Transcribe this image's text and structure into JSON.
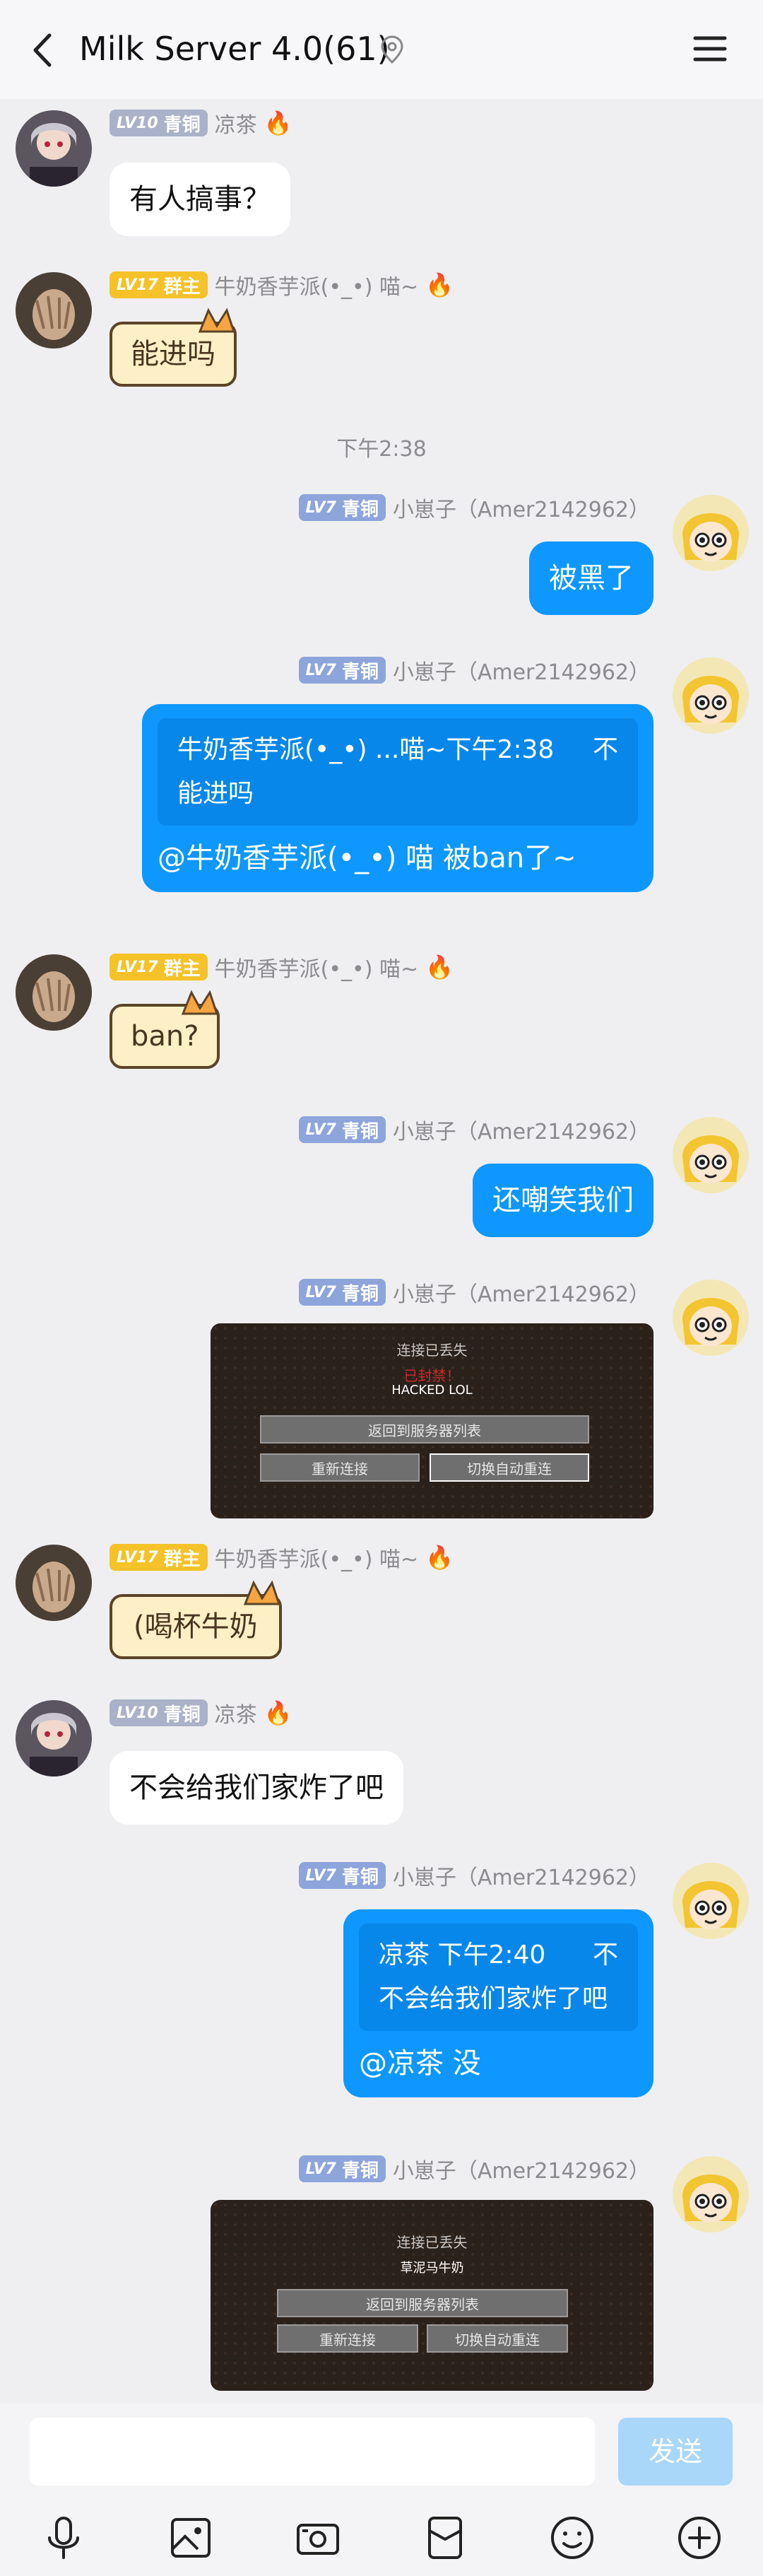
{
  "header": {
    "title": "Milk Server 4.0(61)"
  },
  "time_divider": "下午2:38",
  "users": {
    "liangcha": {
      "level": "LV10",
      "rank": "青铜",
      "name": "凉茶"
    },
    "niunai": {
      "level": "LV17",
      "rank": "群主",
      "name": "牛奶香芋派(•_•) 喵~"
    },
    "xiaozaizi": {
      "level": "LV7",
      "rank": "青铜",
      "name": "小崽子（Amer2142962）"
    }
  },
  "messages": {
    "m1": "有人搞事？",
    "m2": "能进吗",
    "m3": "被黑了",
    "m4_quote_line1": "牛奶香芋派(•_•) ...喵~下午2:38",
    "m4_quote_right": "不",
    "m4_quote_line2": "能进吗",
    "m4_text": "@牛奶香芋派(•_•) 喵 被ban了~",
    "m5": "ban?",
    "m6": "还嘲笑我们",
    "m8": "(喝杯牛奶",
    "m9": "不会给我们家炸了吧",
    "m10_quote_line1": "凉茶 下午2:40",
    "m10_quote_right": "不",
    "m10_quote_line2": "不会给我们家炸了吧",
    "m10_text": "@凉茶 没"
  },
  "screenshot1": {
    "title": "连接已丢失",
    "red": "已封禁！",
    "white": "HACKED LOL",
    "btn_back": "返回到服务器列表",
    "btn_reconnect": "重新连接",
    "btn_toggle": "切换自动重连"
  },
  "screenshot2": {
    "title": "连接已丢失",
    "white": "草泥马牛奶",
    "btn_back": "返回到服务器列表",
    "btn_reconnect": "重新连接",
    "btn_toggle": "切换自动重连"
  },
  "input": {
    "send_label": "发送"
  },
  "icons": {
    "back": "back-arrow-icon",
    "pin": "location-pin-icon",
    "menu": "menu-icon",
    "fire": "fire-icon"
  }
}
